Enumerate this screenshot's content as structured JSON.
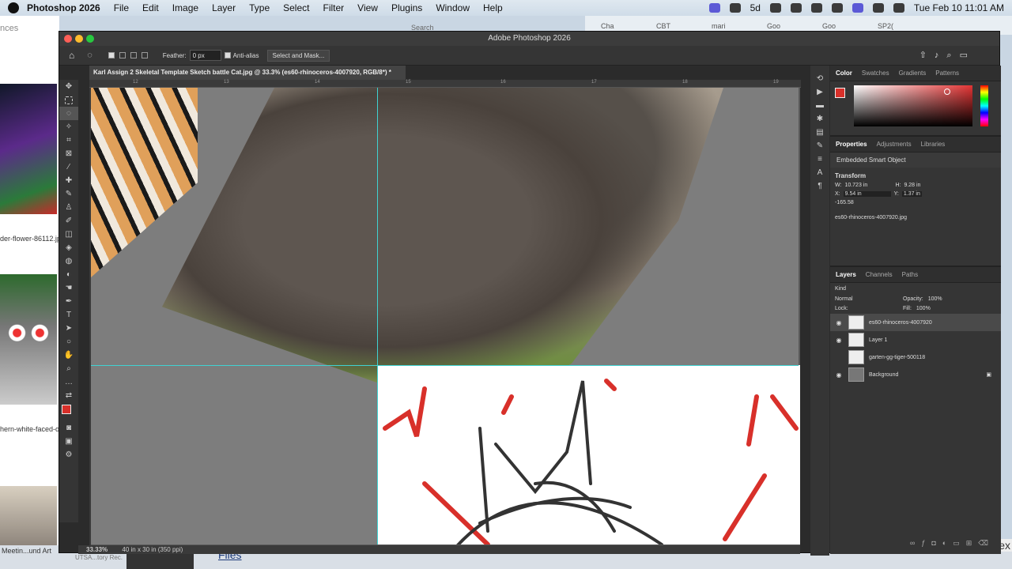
{
  "menubar": {
    "app_name": "Photoshop 2026",
    "items": [
      "File",
      "Edit",
      "Image",
      "Layer",
      "Type",
      "Select",
      "Filter",
      "View",
      "Plugins",
      "Window",
      "Help"
    ],
    "clock": "Tue Feb 10  11:01 AM",
    "badge": "5d"
  },
  "background_window": {
    "partial_title": "nces",
    "labels": [
      "der-flower-86112.jp",
      "hern-white-faced-o"
    ]
  },
  "browser": {
    "search_placeholder": "Search",
    "tabs": [
      "Cha",
      "CBT",
      "mari",
      "Goo",
      "Goo",
      "SP2("
    ]
  },
  "taskbar": {
    "item1": "Meetin...und Art",
    "item2": "UTSA...tory Rec.",
    "files": "Files",
    "right_text": "ex"
  },
  "photoshop": {
    "window_title": "Adobe Photoshop 2026",
    "options": {
      "feather_label": "Feather:",
      "feather_value": "0 px",
      "anti_alias": "Anti-alias",
      "select_mask": "Select and Mask..."
    },
    "doc_tab": "Karl Assign 2 Skeletal Template Sketch battle Cat.jpg @ 33.3% (es60-rhinoceros-4007920, RGB/8*) *",
    "ruler_ticks": [
      "12",
      "13",
      "14",
      "15",
      "16",
      "17",
      "18",
      "19"
    ],
    "status": {
      "zoom": "33.33%",
      "size": "40 in x 30 in (350 ppi)"
    },
    "colors": {
      "foreground": "#d8302a",
      "canvas_bg": "#7d7d7d",
      "guide": "#3fd2d2"
    },
    "color_panel": {
      "tabs": [
        "Color",
        "Swatches",
        "Gradients",
        "Patterns"
      ],
      "active": "Color"
    },
    "properties_panel": {
      "tabs": [
        "Properties",
        "Adjustments",
        "Libraries"
      ],
      "active": "Properties",
      "type": "Embedded Smart Object",
      "transform_label": "Transform",
      "w_label": "W:",
      "w_value": "10.723 in",
      "h_label": "H:",
      "h_value": "9.28 in",
      "x_label": "X:",
      "x_value": "9.54 in",
      "y_label": "Y:",
      "y_value": "1.37 in",
      "angle_value": "-165.58",
      "filename": "es60-rhinoceros-4007920.jpg"
    },
    "layers_panel": {
      "tabs": [
        "Layers",
        "Channels",
        "Paths"
      ],
      "active": "Layers",
      "kind_label": "Kind",
      "blend_mode": "Normal",
      "opacity_label": "Opacity:",
      "opacity_value": "100%",
      "lock_label": "Lock:",
      "fill_label": "Fill:",
      "fill_value": "100%",
      "layers": [
        {
          "name": "es60-rhinoceros-4007920",
          "visible": true,
          "selected": true
        },
        {
          "name": "Layer 1",
          "visible": true,
          "selected": false
        },
        {
          "name": "garten-gg-tiger-500118",
          "visible": false,
          "selected": false
        },
        {
          "name": "Background",
          "visible": true,
          "selected": false,
          "locked": true
        }
      ]
    }
  }
}
